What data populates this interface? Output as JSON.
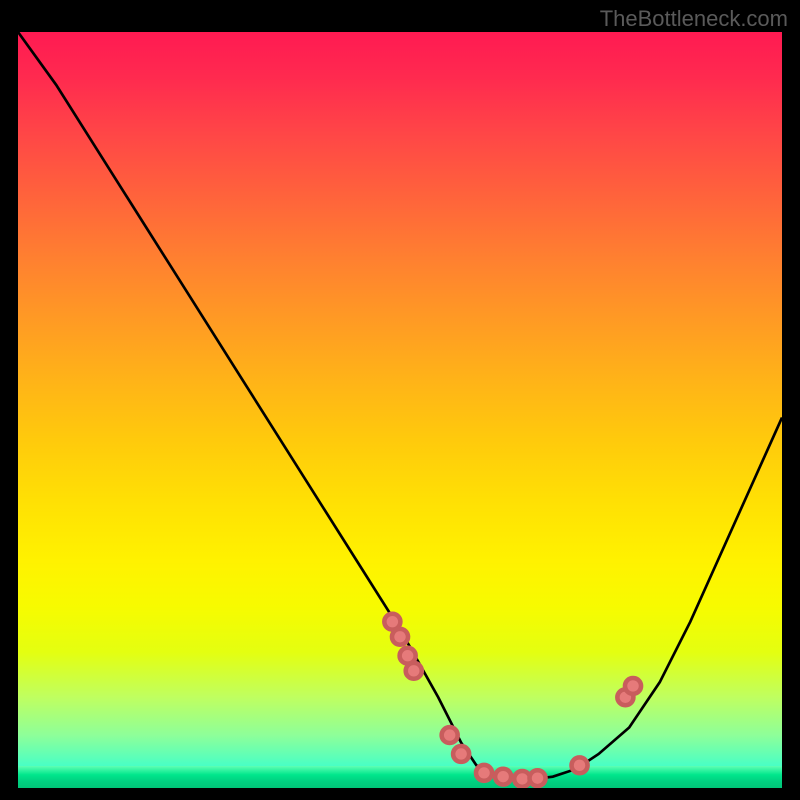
{
  "watermark": "TheBottleneck.com",
  "chart_data": {
    "type": "line",
    "title": "",
    "xlabel": "",
    "ylabel": "",
    "xlim": [
      0,
      100
    ],
    "ylim": [
      0,
      100
    ],
    "grid": false,
    "legend": false,
    "background_gradient": {
      "top": "#ff1a52",
      "middle": "#ffe000",
      "bottom": "#00e68c"
    },
    "series": [
      {
        "name": "bottleneck-curve",
        "color": "#000000",
        "x": [
          0,
          5,
          10,
          15,
          20,
          25,
          30,
          35,
          40,
          45,
          50,
          55,
          58,
          60,
          63,
          66,
          70,
          73,
          76,
          80,
          84,
          88,
          92,
          96,
          100
        ],
        "y": [
          100,
          93,
          85,
          77,
          69,
          61,
          53,
          45,
          37,
          29,
          21,
          12,
          6,
          3,
          1.5,
          1,
          1.5,
          2.5,
          4.5,
          8,
          14,
          22,
          31,
          40,
          49
        ]
      }
    ],
    "markers": {
      "name": "highlight-points",
      "color": "#e67a7a",
      "x": [
        49.0,
        50.0,
        51.0,
        51.8,
        56.5,
        58.0,
        61.0,
        63.5,
        66.0,
        68.0,
        73.5,
        79.5,
        80.5
      ],
      "y": [
        22.0,
        20.0,
        17.5,
        15.5,
        7.0,
        4.5,
        2.0,
        1.5,
        1.2,
        1.3,
        3.0,
        12.0,
        13.5
      ]
    }
  }
}
